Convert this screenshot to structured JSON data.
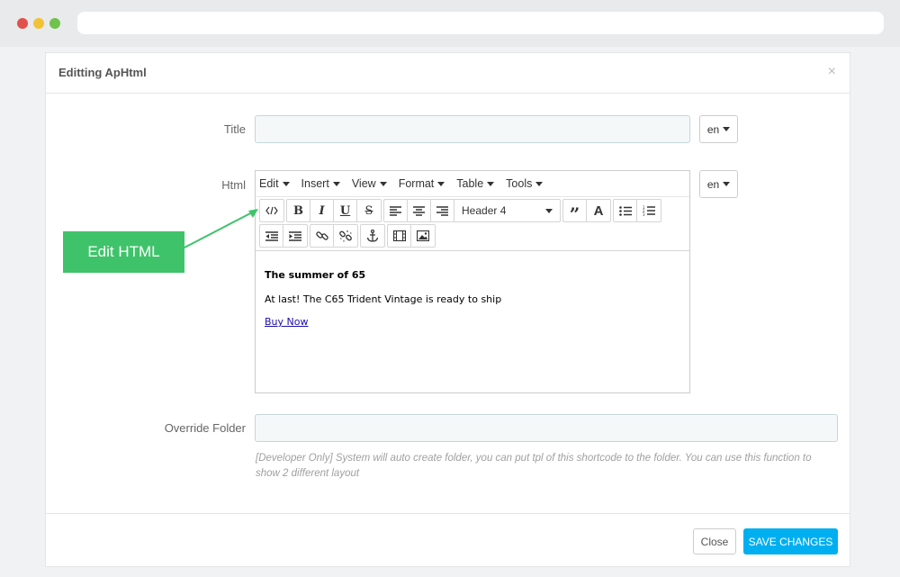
{
  "modal": {
    "title": "Editting ApHtml",
    "close_symbol": "×"
  },
  "form": {
    "title_label": "Title",
    "title_value": "",
    "title_lang": "en",
    "html_label": "Html",
    "html_lang": "en",
    "override_label": "Override Folder",
    "override_value": "",
    "override_help": "[Developer Only] System will auto create folder, you can put tpl of this shortcode to the folder. You can use this function to show 2 different layout"
  },
  "editor": {
    "menus": [
      "Edit",
      "Insert",
      "View",
      "Format",
      "Table",
      "Tools"
    ],
    "block_format": "Header 4",
    "toolbar_icons": [
      "code-icon",
      "bold-icon",
      "italic-icon",
      "underline-icon",
      "strikethrough-icon",
      "align-left-icon",
      "align-center-icon",
      "align-right-icon",
      "blockquote-icon",
      "text-color-icon",
      "bullet-list-icon",
      "numbered-list-icon",
      "outdent-icon",
      "indent-icon",
      "link-icon",
      "unlink-icon",
      "anchor-icon",
      "media-icon",
      "image-icon"
    ],
    "content": {
      "headline": "The summer of 65",
      "paragraph": "At last! The C65 Trident Vintage is ready to ship",
      "link": "Buy Now"
    }
  },
  "footer": {
    "close_label": "Close",
    "save_label": "SAVE CHANGES"
  },
  "annotation": {
    "label": "Edit HTML",
    "color": "#3fc36a"
  },
  "colors": {
    "primary": "#00aff0"
  }
}
